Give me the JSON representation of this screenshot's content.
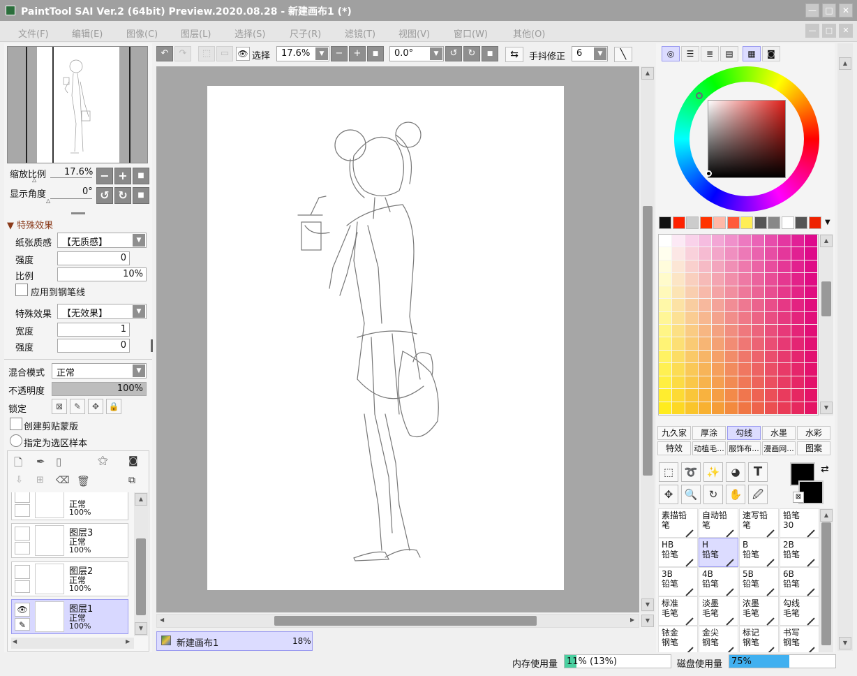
{
  "app": {
    "title": "PaintTool SAI Ver.2 (64bit) Preview.2020.08.28 - 新建画布1 (*)",
    "win_min": "—",
    "win_max": "□",
    "win_close": "✕"
  },
  "menu": [
    "文件(F)",
    "编辑(E)",
    "图像(C)",
    "图层(L)",
    "选择(S)",
    "尺子(R)",
    "滤镜(T)",
    "视图(V)",
    "窗口(W)",
    "其他(O)"
  ],
  "navigator": {
    "zoom_label": "缩放比例",
    "zoom_value": "17.6%",
    "angle_label": "显示角度",
    "angle_value": "0°"
  },
  "effects": {
    "section_title": "特殊效果",
    "paper_label": "纸张质感",
    "paper_value": "【无质感】",
    "strength_label": "强度",
    "strength_value": "0",
    "scale_label": "比例",
    "scale_value": "10%",
    "apply_pen_label": "应用到钢笔线",
    "effect_label": "特殊效果",
    "effect_value": "【无效果】",
    "width_label": "宽度",
    "width_value": "1",
    "strength2_label": "强度",
    "strength2_value": "0"
  },
  "layer_props": {
    "blend_label": "混合模式",
    "blend_value": "正常",
    "opacity_label": "不透明度",
    "opacity_value": "100%",
    "opacity_fraction": 1.0,
    "lock_label": "锁定",
    "clip_label": "创建剪贴蒙版",
    "sample_label": "指定为选区样本"
  },
  "layers": [
    {
      "name": "",
      "mode": "正常",
      "opacity": "100%",
      "selected": false
    },
    {
      "name": "图层3",
      "mode": "正常",
      "opacity": "100%",
      "selected": false
    },
    {
      "name": "图层2",
      "mode": "正常",
      "opacity": "100%",
      "selected": false
    },
    {
      "name": "图层1",
      "mode": "正常",
      "opacity": "100%",
      "selected": true
    }
  ],
  "toolbar": {
    "select_label": "选择",
    "zoom_value": "17.6%",
    "angle_value": "0.0°",
    "stabilizer_label": "手抖修正",
    "stabilizer_value": "6"
  },
  "document_tab": {
    "name": "新建画布1",
    "zoom": "18%"
  },
  "color_panel": {
    "palette": [
      "#111111",
      "#ff2200",
      "#cccccc",
      "#ff3300",
      "#ffb8a8",
      "#ff5a3a",
      "#ffee55",
      "#555555",
      "#888888",
      "#ffffff",
      "#555555",
      "#ee2200"
    ],
    "foreground": "#000000",
    "background": "#000000"
  },
  "brush_sets": {
    "row1": [
      "九久家",
      "厚涂",
      "勾线",
      "水墨",
      "水彩"
    ],
    "row2": [
      "特效",
      "动植毛...",
      "服饰布...",
      "漫画网...",
      "图案"
    ],
    "selected": "勾线"
  },
  "brushes": [
    {
      "l1": "素描铅笔",
      "l2": ""
    },
    {
      "l1": "自动铅笔",
      "l2": ""
    },
    {
      "l1": "速写铅笔",
      "l2": ""
    },
    {
      "l1": "铅笔",
      "l2": "30"
    },
    {
      "l1": "HB",
      "l2": "铅笔"
    },
    {
      "l1": "H",
      "l2": "铅笔",
      "selected": true
    },
    {
      "l1": "B",
      "l2": "铅笔"
    },
    {
      "l1": "2B",
      "l2": "铅笔"
    },
    {
      "l1": "3B",
      "l2": "铅笔"
    },
    {
      "l1": "4B",
      "l2": "铅笔"
    },
    {
      "l1": "5B",
      "l2": "铅笔"
    },
    {
      "l1": "6B",
      "l2": "铅笔"
    },
    {
      "l1": "标准",
      "l2": "毛笔"
    },
    {
      "l1": "淡墨",
      "l2": "毛笔"
    },
    {
      "l1": "浓墨",
      "l2": "毛笔"
    },
    {
      "l1": "勾线",
      "l2": "毛笔"
    },
    {
      "l1": "铱金",
      "l2": "钢笔"
    },
    {
      "l1": "金尖",
      "l2": "钢笔"
    },
    {
      "l1": "标记",
      "l2": "钢笔"
    },
    {
      "l1": "书写",
      "l2": "钢笔"
    }
  ],
  "status": {
    "mem_label": "内存使用量",
    "mem_value": "11% (13%)",
    "mem_fraction": 0.11,
    "disk_label": "磁盘使用量",
    "disk_value": "75%",
    "disk_fraction": 0.75
  }
}
